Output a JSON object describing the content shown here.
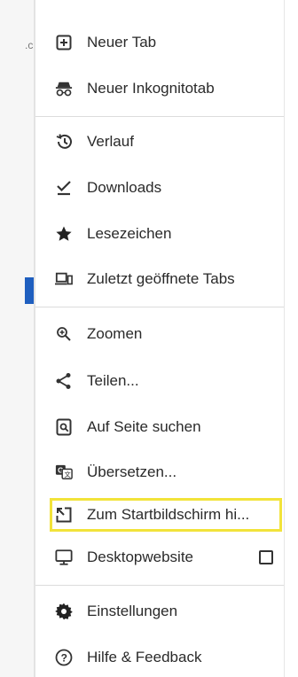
{
  "menu": {
    "items": [
      {
        "label": "Neuer Tab",
        "icon": "new-tab-icon"
      },
      {
        "label": "Neuer Inkognitotab",
        "icon": "incognito-icon"
      },
      {
        "label": "Verlauf",
        "icon": "history-icon"
      },
      {
        "label": "Downloads",
        "icon": "download-icon"
      },
      {
        "label": "Lesezeichen",
        "icon": "star-icon"
      },
      {
        "label": "Zuletzt geöffnete Tabs",
        "icon": "recent-tabs-icon"
      },
      {
        "label": "Zoomen",
        "icon": "zoom-icon"
      },
      {
        "label": "Teilen...",
        "icon": "share-icon"
      },
      {
        "label": "Auf Seite suchen",
        "icon": "find-in-page-icon"
      },
      {
        "label": "Übersetzen...",
        "icon": "translate-icon"
      },
      {
        "label": "Zum Startbildschirm hi...",
        "icon": "add-to-home-icon"
      },
      {
        "label": "Desktopwebsite",
        "icon": "desktop-icon",
        "checked": false
      },
      {
        "label": "Einstellungen",
        "icon": "gear-icon"
      },
      {
        "label": "Hilfe & Feedback",
        "icon": "help-icon"
      }
    ],
    "highlight_color": "#f2e33a"
  }
}
